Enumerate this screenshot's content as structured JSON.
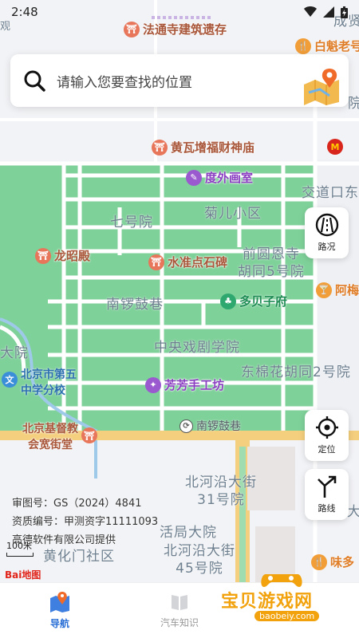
{
  "status": {
    "time": "2:48"
  },
  "search": {
    "placeholder": "请输入您要查找的位置"
  },
  "side_buttons": {
    "traffic": "路况",
    "locate": "定位",
    "route": "路线"
  },
  "map": {
    "pois": {
      "fatongsi": "法通寺建筑遗存",
      "baikui": "白魁老号",
      "huangwa": "黄瓦增福财神庙",
      "duwai": "度外画室",
      "longzhao": "龙昭殿",
      "shuizhun": "水准点石碑",
      "duobeizi": "多贝子府",
      "fangfang": "芳芳手工坊",
      "beijing_school_1": "北京市第五",
      "beijing_school_2": "中学分校",
      "church_1": "北京基督教",
      "church_2": "会宽街堂",
      "nanluoguxiang_bus": "南锣鼓巷",
      "ameiyi": "阿梅",
      "weiduo": "味多"
    },
    "areas": {
      "chengxian": "成贤",
      "yuan": "院",
      "jiaodaokou": "交道口东",
      "qihao": "七号院",
      "juer": "菊儿小区",
      "qianyuan_1": "前圆恩寺",
      "qianyuan_2": "胡同5号院",
      "nanluogu": "南锣鼓巷",
      "zhongxi": "中央戏剧学院",
      "dongmian": "东棉花胡同2号院",
      "dayuan": "大院",
      "beihe31_1": "北河沿大街",
      "beihe31_2": "31号院",
      "juda": "活局大院",
      "beihe45_1": "北河沿大街",
      "beihe45_2": "45号院",
      "huanghua": "黄化门社区",
      "da": "大",
      "left_edge": "观"
    }
  },
  "credits": {
    "line1": "审图号：GS（2024）4841",
    "line2": "资质编号：甲测资字11111093",
    "line3": "高德软件有限公司提供"
  },
  "scale": "100米",
  "baidu_logo": "Bai地图",
  "tabs": [
    {
      "label": "导航",
      "active": true
    },
    {
      "label": "汽车知识",
      "active": false
    }
  ],
  "watermark": {
    "title": "宝贝游戏网",
    "url": "baobeiy.com"
  },
  "colors": {
    "accent": "#2a6fd6",
    "park_green": "#7bcf96",
    "road": "#ffffff",
    "main_road": "#f4cf7d"
  }
}
